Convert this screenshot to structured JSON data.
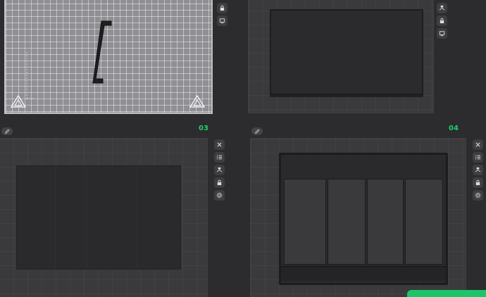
{
  "plates": [
    {
      "id": "plate-1",
      "number": "",
      "active": true,
      "tools": [
        "lock-icon",
        "orient-icon"
      ]
    },
    {
      "id": "plate-2",
      "number": "",
      "active": false,
      "tools": [
        "arrange-icon",
        "lock-icon",
        "orient-icon"
      ]
    },
    {
      "id": "plate-3",
      "number": "03",
      "active": false,
      "tools": [
        "close-icon",
        "list-icon",
        "arrange-icon",
        "lock-icon",
        "settings-icon"
      ]
    },
    {
      "id": "plate-4",
      "number": "04",
      "active": false,
      "tools": [
        "close-icon",
        "list-icon",
        "arrange-icon",
        "lock-icon",
        "settings-icon"
      ]
    }
  ],
  "colors": {
    "accent": "#1ecf6e",
    "background": "#2c2c2e",
    "plate": "#3a3a3d",
    "active_plate": "#8f8f94",
    "object": "#2a2a2c"
  }
}
